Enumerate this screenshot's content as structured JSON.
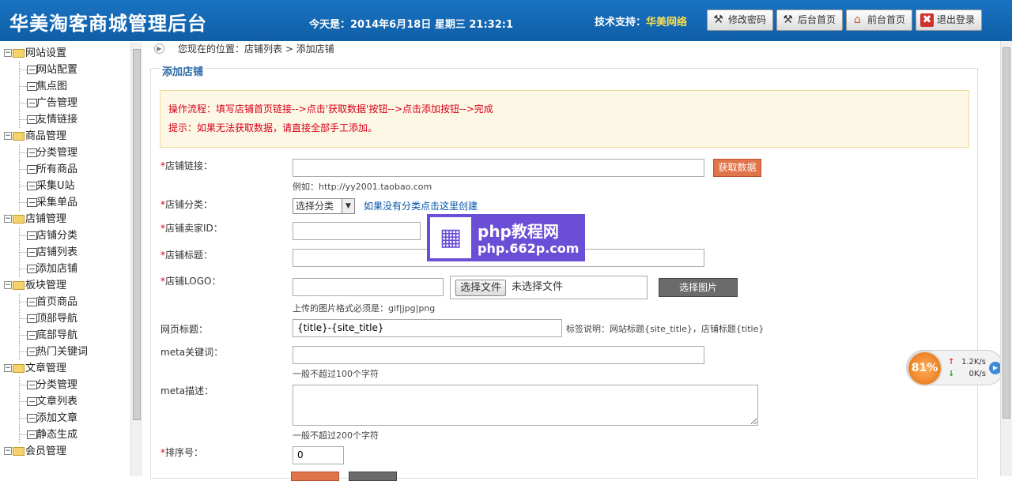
{
  "header": {
    "title": "华美淘客商城管理后台",
    "date": "今天是：2014年6月18日 星期三 21:32:1",
    "support_label": "技术支持：",
    "support_name": "华美网络",
    "buttons": [
      {
        "label": "修改密码",
        "icon": "tools-icon"
      },
      {
        "label": "后台首页",
        "icon": "tools-icon"
      },
      {
        "label": "前台首页",
        "icon": "home-icon"
      },
      {
        "label": "退出登录",
        "icon": "close-icon"
      }
    ]
  },
  "sidebar": {
    "groups": [
      {
        "label": "网站设置",
        "items": [
          "网站配置",
          "焦点图",
          "广告管理",
          "友情链接"
        ]
      },
      {
        "label": "商品管理",
        "items": [
          "分类管理",
          "所有商品",
          "采集U站",
          "采集单品"
        ]
      },
      {
        "label": "店铺管理",
        "items": [
          "店铺分类",
          "店铺列表",
          "添加店铺"
        ]
      },
      {
        "label": "板块管理",
        "items": [
          "首页商品",
          "顶部导航",
          "底部导航",
          "热门关键词"
        ]
      },
      {
        "label": "文章管理",
        "items": [
          "分类管理",
          "文章列表",
          "添加文章",
          "静态生成"
        ]
      },
      {
        "label": "会员管理",
        "items": []
      }
    ]
  },
  "breadcrumb": "您现在的位置：店铺列表 > 添加店铺",
  "panel_title": "添加店铺",
  "notice": {
    "line1": "操作流程：填写店铺首页链接-->点击'获取数据'按钮-->点击添加按钮-->完成",
    "line2": "提示：如果无法获取数据，请直接全部手工添加。"
  },
  "form": {
    "shop_link_label": "店铺链接：",
    "fetch_button": "获取数据",
    "shop_link_example": "例如：http://yy2001.taobao.com",
    "category_label": "店铺分类：",
    "category_selected": "选择分类",
    "category_link": "如果没有分类点击这里创建",
    "seller_id_label": "店铺卖家ID：",
    "shop_title_label": "店铺标题：",
    "logo_label": "店铺LOGO：",
    "file_button": "选择文件",
    "file_status": "未选择文件",
    "choose_image_button": "选择图片",
    "logo_hint": "上传的图片格式必须是：gif|jpg|png",
    "page_title_label": "网页标题：",
    "page_title_value": "{title}-{site_title}",
    "page_title_hint": "标签说明：网站标题{site_title}，店铺标题{title}",
    "keywords_label": "meta关键词：",
    "keywords_hint": "一般不超过100个字符",
    "desc_label": "meta描述：",
    "desc_hint": "一般不超过200个字符",
    "sort_label": "排序号：",
    "sort_value": "0",
    "required_mark": "*"
  },
  "watermark": {
    "line1": "php教程网",
    "line2": "php.662p.com"
  },
  "speed_widget": {
    "percent": "81%",
    "up": "1.2K/s",
    "down": "0K/s"
  }
}
